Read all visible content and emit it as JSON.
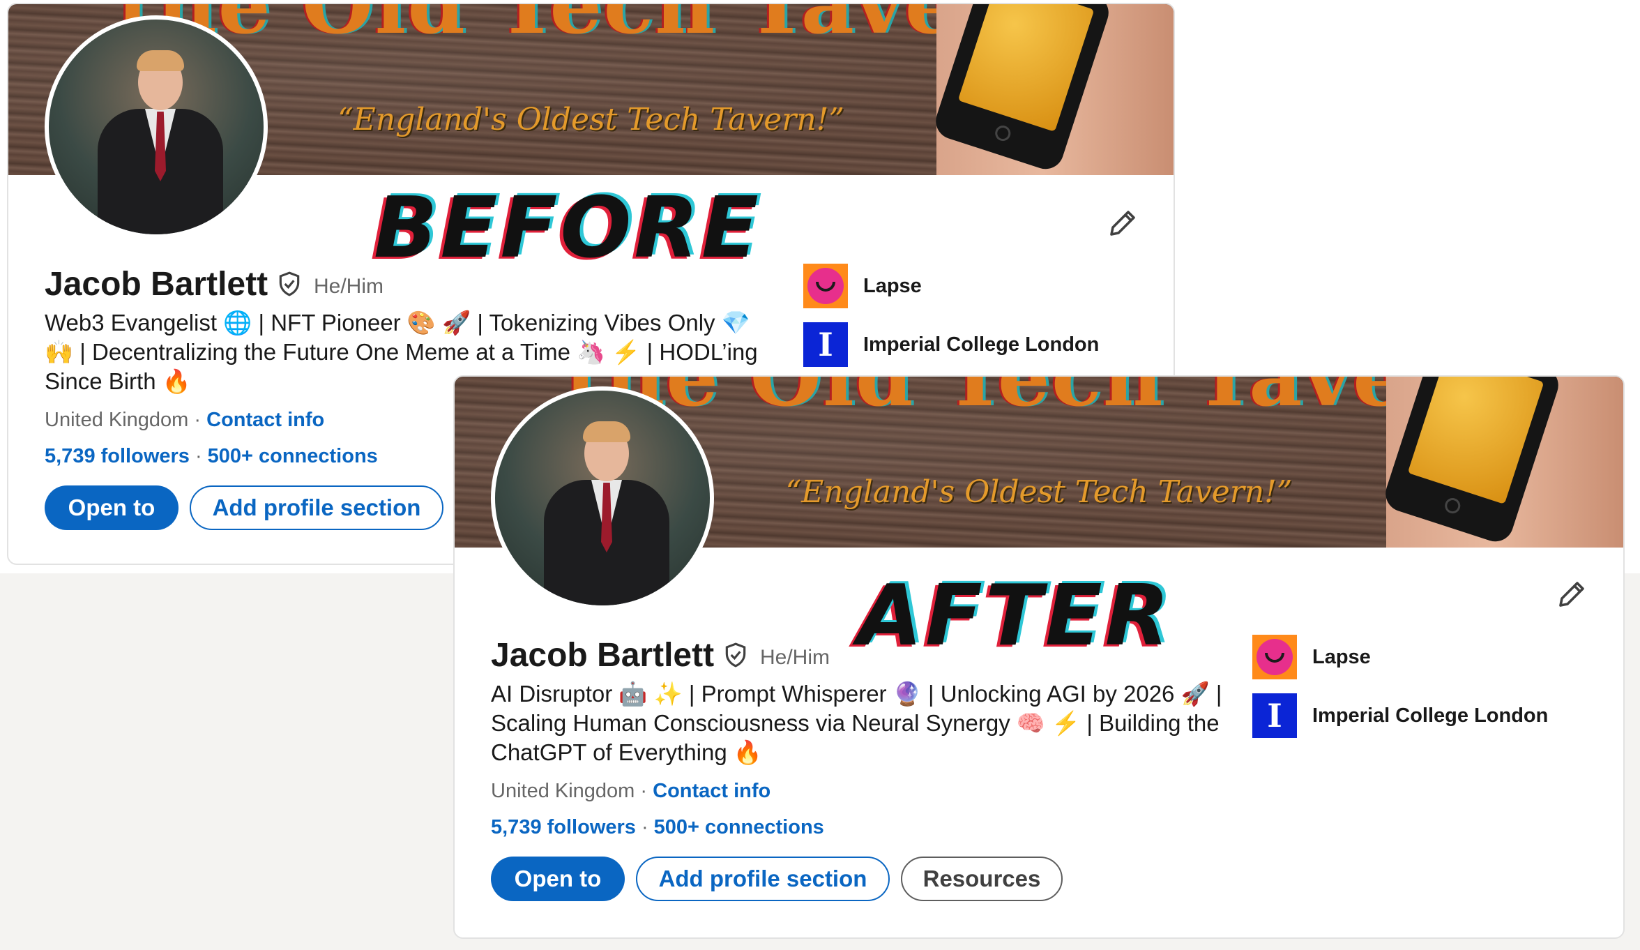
{
  "banner": {
    "title": "the Old Tech Tavern",
    "tagline": "“England's Oldest Tech Tavern!”"
  },
  "before": {
    "label": "BEFORE",
    "name": "Jacob Bartlett",
    "pronouns": "He/Him",
    "headline": "Web3 Evangelist 🌐 | NFT Pioneer 🎨 🚀 | Tokenizing Vibes Only 💎 🙌 | Decentralizing the Future One Meme at a Time 🦄 ⚡ | HODL’ing Since Birth 🔥",
    "location": "United Kingdom",
    "contact_info": "Contact info",
    "followers": "5,739 followers",
    "connections": "500+ connections",
    "buttons": {
      "open_to": "Open to",
      "add_section": "Add profile section"
    },
    "orgs": [
      {
        "name": "Lapse"
      },
      {
        "name": "Imperial College London"
      }
    ]
  },
  "after": {
    "label": "AFTER",
    "name": "Jacob Bartlett",
    "pronouns": "He/Him",
    "headline": "AI Disruptor 🤖 ✨ | Prompt Whisperer 🔮 | Unlocking AGI by 2026 🚀 | Scaling Human Consciousness via Neural Synergy 🧠 ⚡ | Building the ChatGPT of Everything 🔥",
    "location": "United Kingdom",
    "contact_info": "Contact info",
    "followers": "5,739 followers",
    "connections": "500+ connections",
    "buttons": {
      "open_to": "Open to",
      "add_section": "Add profile section",
      "resources": "Resources"
    },
    "orgs": [
      {
        "name": "Lapse"
      },
      {
        "name": "Imperial College London"
      }
    ]
  },
  "icons": {
    "verified": "shield-check-icon",
    "edit": "pencil-icon",
    "lapse_logo": "lapse-logo",
    "imperial_logo": "imperial-logo",
    "imperial_letter": "I"
  },
  "colors": {
    "linkedin_blue": "#0a66c2",
    "label_cyan": "#2ec7d6",
    "label_red": "#e0203a"
  }
}
